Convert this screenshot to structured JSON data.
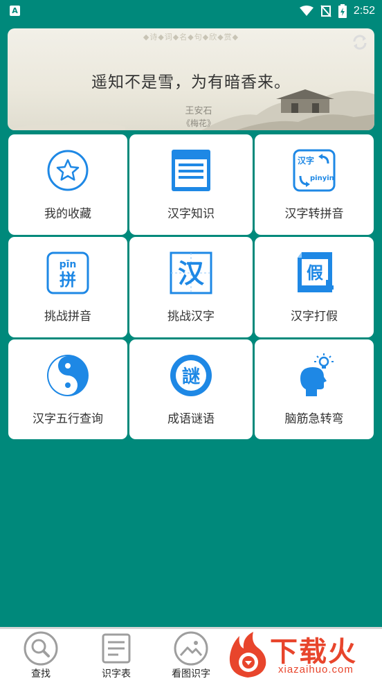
{
  "status_bar": {
    "app_icon_letter": "A",
    "time": "2:52",
    "icons": [
      "wifi-icon",
      "signal-off-icon",
      "battery-charging-icon"
    ]
  },
  "banner": {
    "header": "◆诗◆词◆名◆句◆欣◆赏◆",
    "verse": "遥知不是雪，为有暗香来。",
    "author": "王安石",
    "work": "《梅花》"
  },
  "tiles": [
    {
      "label": "我的收藏",
      "icon": "star-icon"
    },
    {
      "label": "汉字知识",
      "icon": "document-icon"
    },
    {
      "label": "汉字转拼音",
      "icon": "hanzi-pinyin-convert-icon"
    },
    {
      "label": "挑战拼音",
      "icon": "pinyin-card-icon"
    },
    {
      "label": "挑战汉字",
      "icon": "hanzi-grid-icon"
    },
    {
      "label": "汉字打假",
      "icon": "fake-stamp-icon"
    },
    {
      "label": "汉字五行查询",
      "icon": "yin-yang-icon"
    },
    {
      "label": "成语谜语",
      "icon": "riddle-seal-icon"
    },
    {
      "label": "脑筋急转弯",
      "icon": "brain-bulb-icon"
    }
  ],
  "icon_text": {
    "hanzi": "汉字",
    "pinyin": "pinyin",
    "pin_top": "pīn",
    "pin_char": "拼",
    "han_char": "汉",
    "jia_char": "假",
    "mi_char": "謎"
  },
  "bottom_nav": [
    {
      "label": "查找",
      "icon": "search-icon"
    },
    {
      "label": "识字表",
      "icon": "list-icon"
    },
    {
      "label": "看图识字",
      "icon": "image-icon"
    }
  ],
  "watermark": {
    "big": "下载火",
    "small": "xiazaihuo.com"
  },
  "colors": {
    "background": "#00897B",
    "icon_blue": "#1E88E5",
    "watermark": "#E8452C"
  }
}
